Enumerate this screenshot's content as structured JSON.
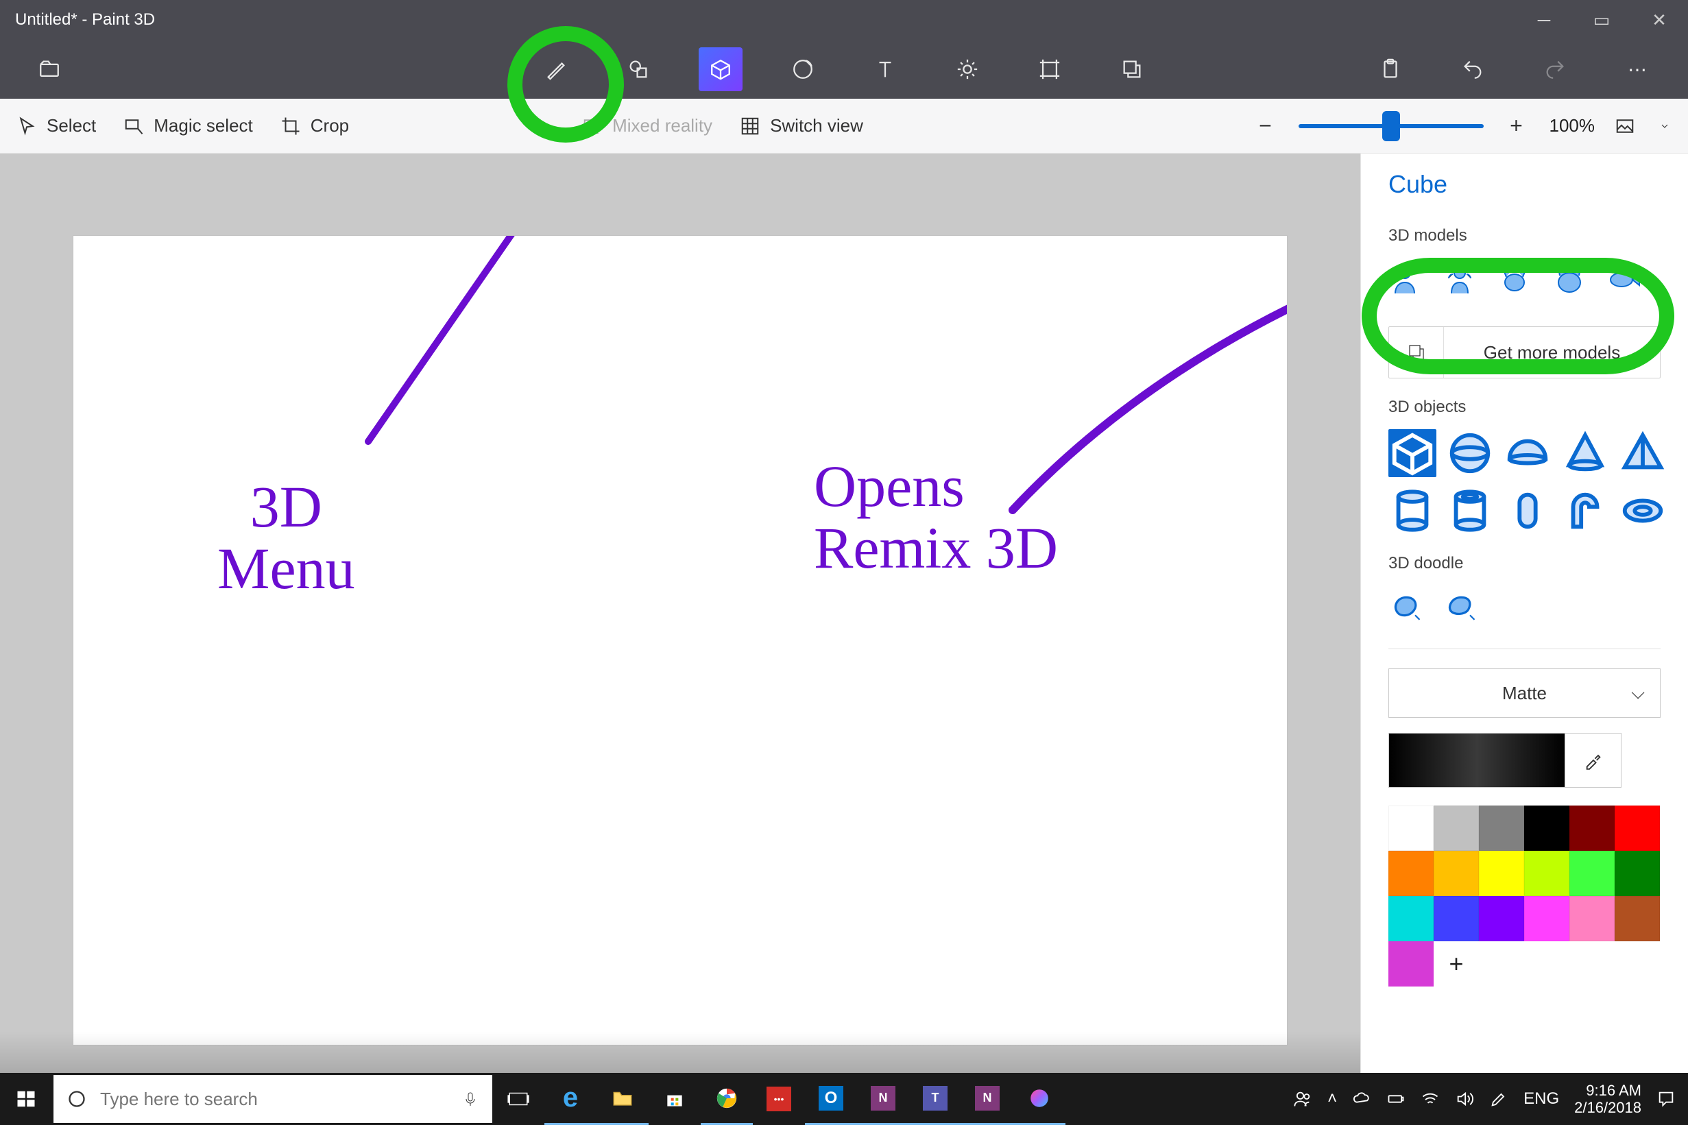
{
  "window": {
    "title": "Untitled* - Paint 3D"
  },
  "ribbon": {
    "tools": [
      "menu",
      "brushes",
      "2d-shapes",
      "3d-shapes",
      "stickers",
      "text",
      "effects",
      "canvas",
      "mixed-reality"
    ],
    "right": [
      "paste",
      "undo",
      "redo",
      "more"
    ]
  },
  "subbar": {
    "select": "Select",
    "magic_select": "Magic select",
    "crop": "Crop",
    "mixed_reality": "Mixed reality",
    "switch_view": "Switch view",
    "zoom_label": "100%"
  },
  "sidepanel": {
    "title": "Cube",
    "models_label": "3D models",
    "more_models_label": "Get more models",
    "objects_label": "3D objects",
    "doodle_label": "3D doodle",
    "material_label": "Matte"
  },
  "palette_colors": [
    "#ffffff",
    "#c0c0c0",
    "#808080",
    "#000000",
    "#800000",
    "#ff0000",
    "#ff8000",
    "#ffc000",
    "#ffff00",
    "#c0ff00",
    "#40ff40",
    "#008000",
    "#00dcdc",
    "#4040ff",
    "#8000ff",
    "#ff40ff",
    "#ff80c0",
    "#b05020"
  ],
  "selected_custom_color": "#d63ad6",
  "annotations": {
    "first_line1": "3D",
    "first_line2": "Menu",
    "second_line1": "Opens",
    "second_line2": "Remix 3D"
  },
  "taskbar": {
    "search_placeholder": "Type here to search",
    "lang": "ENG",
    "time": "9:16 AM",
    "date": "2/16/2018"
  }
}
